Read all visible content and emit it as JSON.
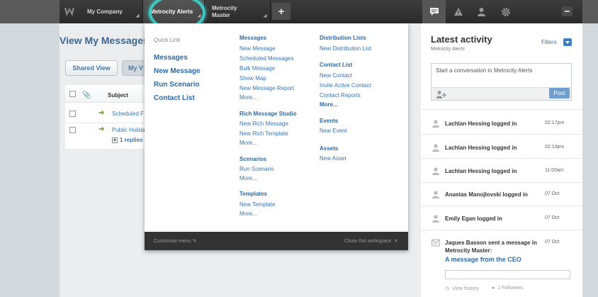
{
  "topbar": {
    "tabs": [
      {
        "label": "My Company"
      },
      {
        "label": "Metrocity Alerts"
      },
      {
        "label": "Metrocity\nMaster"
      }
    ],
    "add_label": "+"
  },
  "main": {
    "title": "View My Messages",
    "buttons": {
      "shared": "Shared View",
      "my": "My V"
    },
    "table": {
      "header_subject": "Subject",
      "rows": [
        {
          "subject": "Scheduled F"
        },
        {
          "subject": "Public Holida"
        }
      ],
      "replies": "1 replies"
    }
  },
  "dropdown": {
    "quick_link_title": "Quick Link",
    "quick_links": [
      "Messages",
      "New Message",
      "Run Scenario",
      "Contact List"
    ],
    "col2": [
      {
        "heading": "Messages",
        "items": [
          "New Message",
          "Scheduled Messages",
          "Bulk Message",
          "Show Map",
          "New Message Report",
          "More..."
        ]
      },
      {
        "heading": "Rich Message Studio",
        "items": [
          "New Rich Message",
          "New Rich Template",
          "More..."
        ]
      },
      {
        "heading": "Scenarios",
        "items": [
          "Run Scenario",
          "More..."
        ]
      },
      {
        "heading": "Templates",
        "items": [
          "New Template",
          "More..."
        ]
      }
    ],
    "col3": [
      {
        "heading": "Distribution Lists",
        "items": [
          "New Distribution List"
        ]
      },
      {
        "heading": "Contact List",
        "items": [
          "New Contact",
          "Invite Active Contact",
          "Contact Reports",
          "More..."
        ]
      },
      {
        "heading": "Events",
        "items": [
          "New Event"
        ]
      },
      {
        "heading": "Assets",
        "items": [
          "New Asset"
        ]
      }
    ],
    "footer": {
      "customise": "Customise menu",
      "close": "Close this workspace"
    }
  },
  "panel": {
    "title": "Latest activity",
    "subtitle": "Metrocity Alerts",
    "filters": "Filters",
    "compose_placeholder": "Start a conversation in Metrocity Alerts",
    "post": "Post",
    "activities": [
      {
        "text": "Lachlan Hessing logged in",
        "time": "02:17pm"
      },
      {
        "text": "Lachlan Hessing logged in",
        "time": "02:14pm"
      },
      {
        "text": "Lachlan Hessing logged in",
        "time": "11:00am"
      },
      {
        "text": "Anastas Manojlovski logged in",
        "time": "07 Oct"
      },
      {
        "text": "Emily Egan logged in",
        "time": "07 Oct"
      }
    ],
    "message": {
      "line1": "Jaques Basson sent a message in",
      "line2": "Metrocity Master:",
      "time": "07 Oct",
      "link": "A message from the CEO",
      "view_history": "View history",
      "followers": "1 Followers"
    }
  },
  "colors": {
    "accent": "#2d6aa6",
    "highlight_ring": "#3ec9c4",
    "topbar": "#333333"
  }
}
